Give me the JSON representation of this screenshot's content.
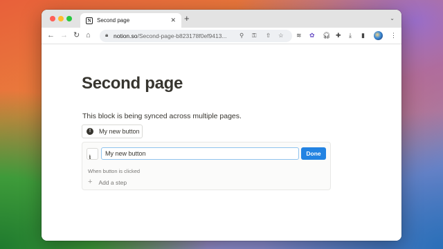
{
  "browser": {
    "tab": {
      "title": "Second page",
      "favicon": "notion-icon",
      "close": "✕"
    },
    "new_tab": "+",
    "tab_menu": "⌄",
    "address": {
      "domain": "notion.so",
      "path": "/Second-page-b823178f0ef9413..."
    },
    "toolbar_icons": [
      "zoom-icon",
      "key-icon",
      "share-icon",
      "bookmark-star-icon",
      "buffer-icon",
      "extension-flower-icon",
      "headphones-icon",
      "puzzle-extensions-icon",
      "download-icon",
      "sidebar-icon",
      "profile-avatar",
      "more-vert-icon"
    ]
  },
  "page": {
    "title": "Second page",
    "text": "This block is being synced across multiple pages.",
    "button": {
      "label": "My new button",
      "icon": "!"
    },
    "editor": {
      "icon": "!",
      "name_value": "My new button",
      "done_label": "Done",
      "trigger_label": "When button is clicked",
      "add_step_label": "Add a step",
      "add_step_icon": "+"
    }
  },
  "colors": {
    "accent": "#2383e2",
    "focus_ring": "#8fc3ee",
    "text": "#37352f"
  }
}
